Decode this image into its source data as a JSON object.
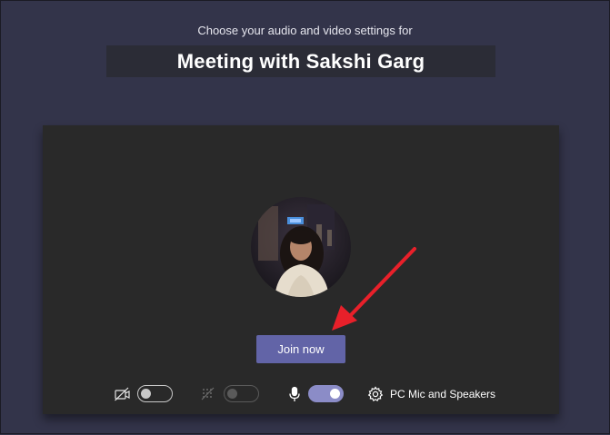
{
  "header": {
    "subtitle": "Choose your audio and video settings for",
    "meeting_title": "Meeting with Sakshi Garg"
  },
  "preview": {
    "join_label": "Join now"
  },
  "controls": {
    "camera": {
      "icon": "camera-off-icon",
      "state": "off"
    },
    "background_blur": {
      "icon": "background-blur-icon",
      "state": "off",
      "enabled": false
    },
    "microphone": {
      "icon": "microphone-icon",
      "state": "on"
    },
    "device_settings": {
      "icon": "gear-icon",
      "label": "PC Mic and Speakers"
    }
  },
  "colors": {
    "page_background": "#33344a",
    "panel_background": "#292929",
    "accent": "#6264a7",
    "toggle_on": "#8b8cc7",
    "annotation_arrow": "#e8202a"
  }
}
